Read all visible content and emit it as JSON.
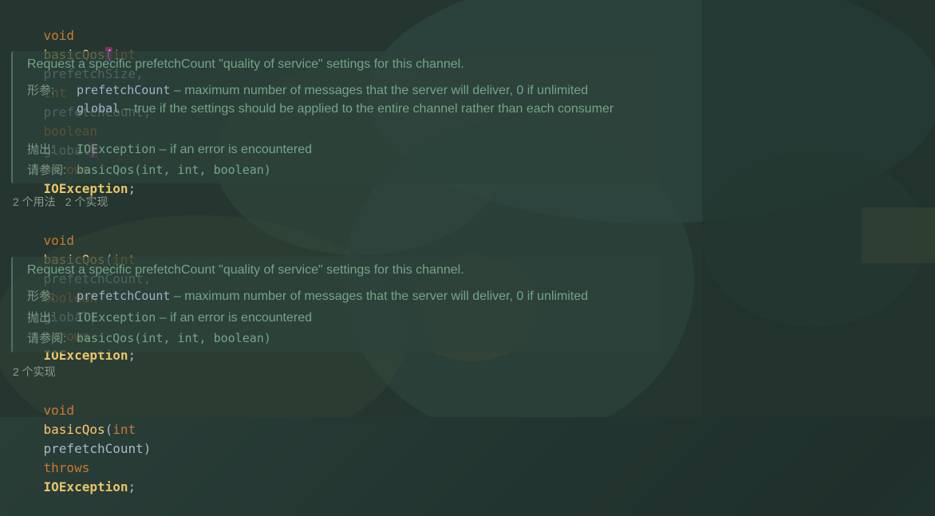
{
  "method1": {
    "kw_void": "void",
    "name": "basicQos",
    "open": "(",
    "p1_type": "int",
    "p1_name": "prefetchSize",
    "comma": ",",
    "p2_type": "int",
    "p2_name": "prefetchCount",
    "p3_type": "boolean",
    "p3_name": "global",
    "close": ")",
    "throws": "throws",
    "exc": "IOException",
    "semi": ";"
  },
  "doc1": {
    "summary": "Request a specific prefetchCount \"quality of service\" settings for this channel.",
    "params_label": "形参:",
    "p1_name": "prefetchCount",
    "p1_desc": " – maximum number of messages that the server will deliver, 0 if unlimited",
    "p2_name": "global",
    "p2_desc": " – true if the settings should be applied to the entire channel rather than each consumer",
    "throws_label": "抛出:",
    "throws_name": "IOException",
    "throws_desc": " – if an error is encountered",
    "see_label": "请参阅:",
    "see_ref": "basicQos(int, int, boolean)"
  },
  "usage1": {
    "usages": "2 个用法",
    "impls": "2 个实现"
  },
  "method2": {
    "kw_void": "void",
    "name": "basicQos",
    "open": "(",
    "p1_type": "int",
    "p1_name": "prefetchCount",
    "comma": ",",
    "p2_type": "boolean",
    "p2_name": "global",
    "close": ")",
    "throws": "throws",
    "exc": "IOException",
    "semi": ";"
  },
  "doc2": {
    "summary": "Request a specific prefetchCount \"quality of service\" settings for this channel.",
    "params_label": "形参:",
    "p1_name": "prefetchCount",
    "p1_desc": " – maximum number of messages that the server will deliver, 0 if unlimited",
    "throws_label": "抛出:",
    "throws_name": "IOException",
    "throws_desc": " – if an error is encountered",
    "see_label": "请参阅:",
    "see_ref": "basicQos(int, int, boolean)"
  },
  "usage2": {
    "impls": "2 个实现"
  },
  "method3": {
    "kw_void": "void",
    "name": "basicQos",
    "open": "(",
    "p1_type": "int",
    "p1_name": "prefetchCount",
    "close": ")",
    "throws": "throws",
    "exc": "IOException",
    "semi": ";"
  },
  "colors": {
    "keyword": "#cc7832",
    "method": "#ffc66d",
    "brace_highlight": "#8a2c6e",
    "doc_text": "#74a48a"
  }
}
